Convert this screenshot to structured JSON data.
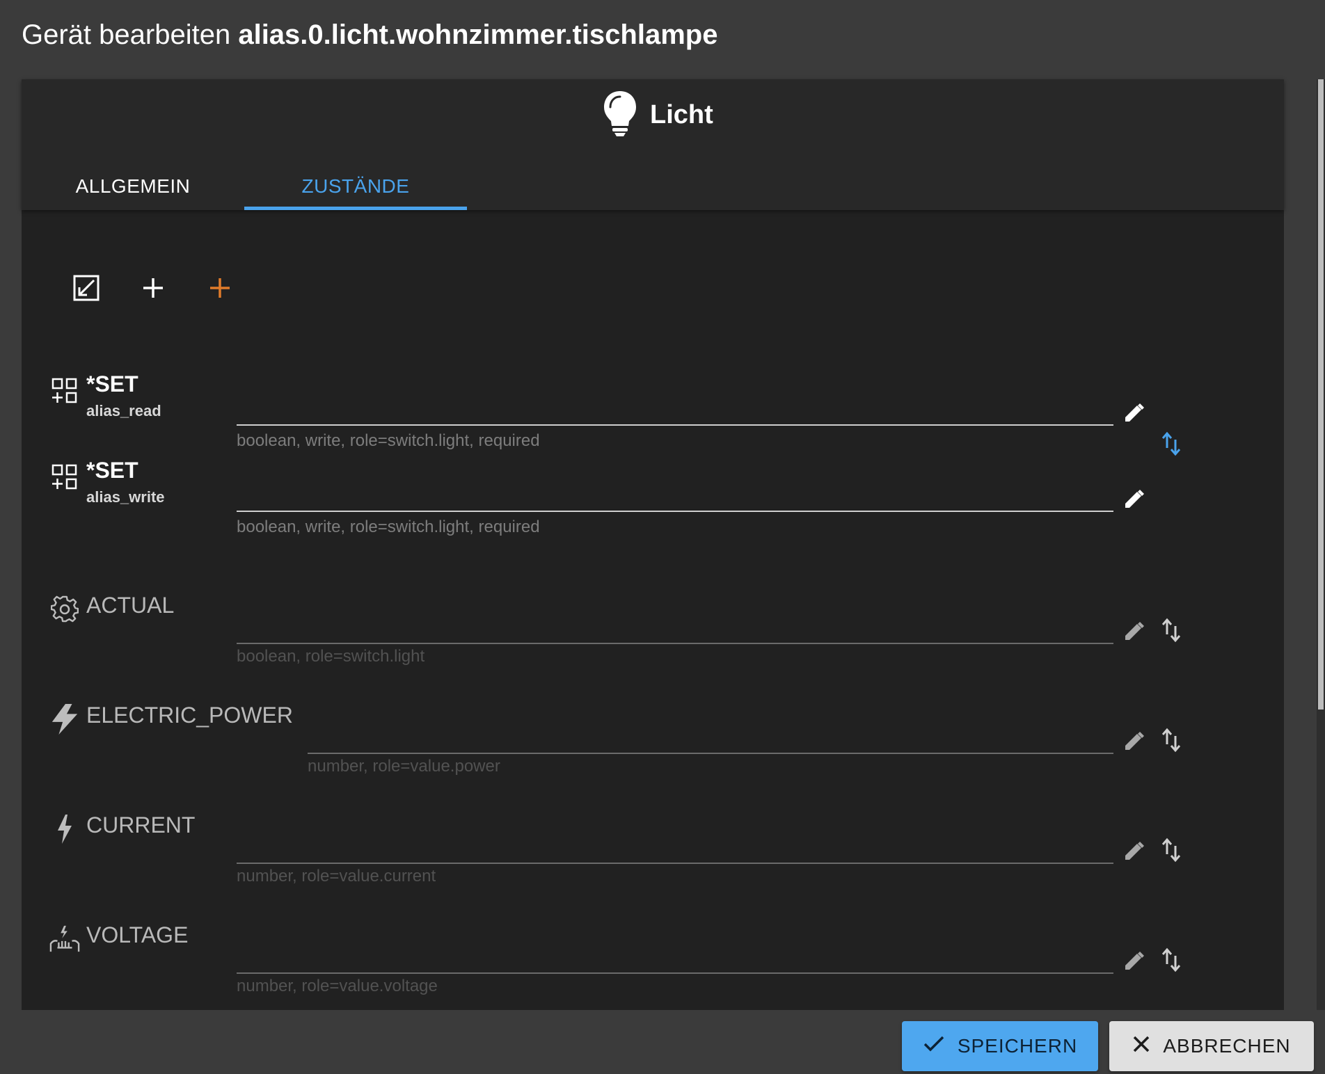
{
  "dialog": {
    "title_prefix": "Gerät bearbeiten",
    "title_id": "alias.0.licht.wohnzimmer.tischlampe"
  },
  "device": {
    "icon": "lightbulb-icon",
    "name": "Licht"
  },
  "tabs": [
    {
      "label": "ALLGEMEIN",
      "active": false
    },
    {
      "label": "ZUSTÄNDE",
      "active": true
    }
  ],
  "toolbar": {
    "icons": [
      "expand-icon",
      "add-icon",
      "add-orange-icon"
    ],
    "accent_color": "#e07b2a"
  },
  "states": [
    {
      "name": "*SET",
      "sub": "alias_read",
      "icon": "state-grid-icon",
      "value": "",
      "helper": "boolean, write, role=switch.light, required",
      "required": true
    },
    {
      "name": "*SET",
      "sub": "alias_write",
      "icon": "state-grid-icon",
      "value": "",
      "helper": "boolean, write, role=switch.light, required",
      "required": true
    },
    {
      "name": "ACTUAL",
      "icon": "gear-icon",
      "value": "",
      "helper": "boolean, role=switch.light",
      "required": false
    },
    {
      "name": "ELECTRIC_POWER",
      "icon": "flash-icon",
      "value": "",
      "helper": "number, role=value.power",
      "required": false
    },
    {
      "name": "CURRENT",
      "icon": "bolt-icon",
      "value": "",
      "helper": "number, role=value.current",
      "required": false
    },
    {
      "name": "VOLTAGE",
      "icon": "voltage-icon",
      "value": "",
      "helper": "number, role=value.voltage",
      "required": false
    }
  ],
  "buttons": {
    "save": "SPEICHERN",
    "cancel": "ABBRECHEN"
  },
  "colors": {
    "accent": "#4aa3ec",
    "background": "#3b3b3b",
    "panel": "#212121"
  }
}
